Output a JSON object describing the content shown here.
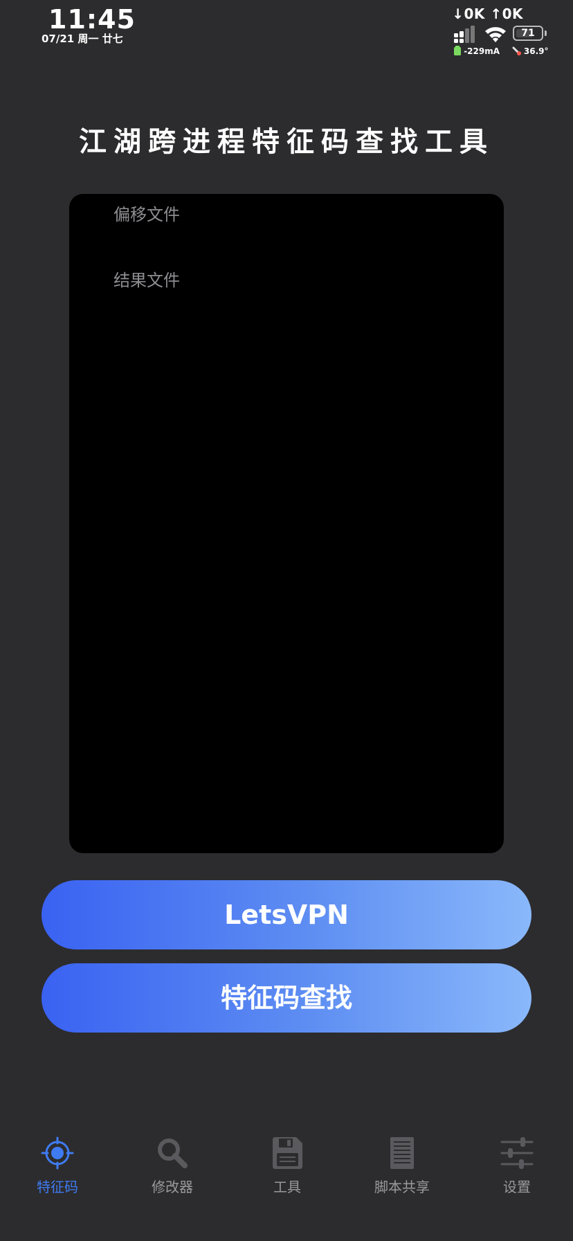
{
  "status_bar": {
    "time": "11:45",
    "date": "07/21 周一 廿七",
    "net_down": "↓0K",
    "net_up": "↑0K",
    "battery_level": 71,
    "battery_label": "71",
    "current": "-229mA",
    "temperature": "36.9°"
  },
  "header": {
    "title": "江湖跨进程特征码查找工具"
  },
  "panel": {
    "offset_placeholder": "偏移文件",
    "result_placeholder": "结果文件"
  },
  "buttons": {
    "vpn_label": "LetsVPN",
    "search_label": "特征码查找"
  },
  "tab_bar": {
    "active_color": "#3f7bf2",
    "inactive_color": "#9a9a9e",
    "items": [
      {
        "label": "特征码",
        "icon": "crosshair-icon",
        "active": true
      },
      {
        "label": "修改器",
        "icon": "magnifier-icon",
        "active": false
      },
      {
        "label": "工具",
        "icon": "floppy-disk-icon",
        "active": false
      },
      {
        "label": "脚本共享",
        "icon": "document-icon",
        "active": false
      },
      {
        "label": "设置",
        "icon": "sliders-icon",
        "active": false
      }
    ]
  },
  "colors": {
    "background": "#2c2c2e",
    "panel": "#000000",
    "button_gradient_start": "#3a62f2",
    "button_gradient_end": "#8ab8fb"
  }
}
